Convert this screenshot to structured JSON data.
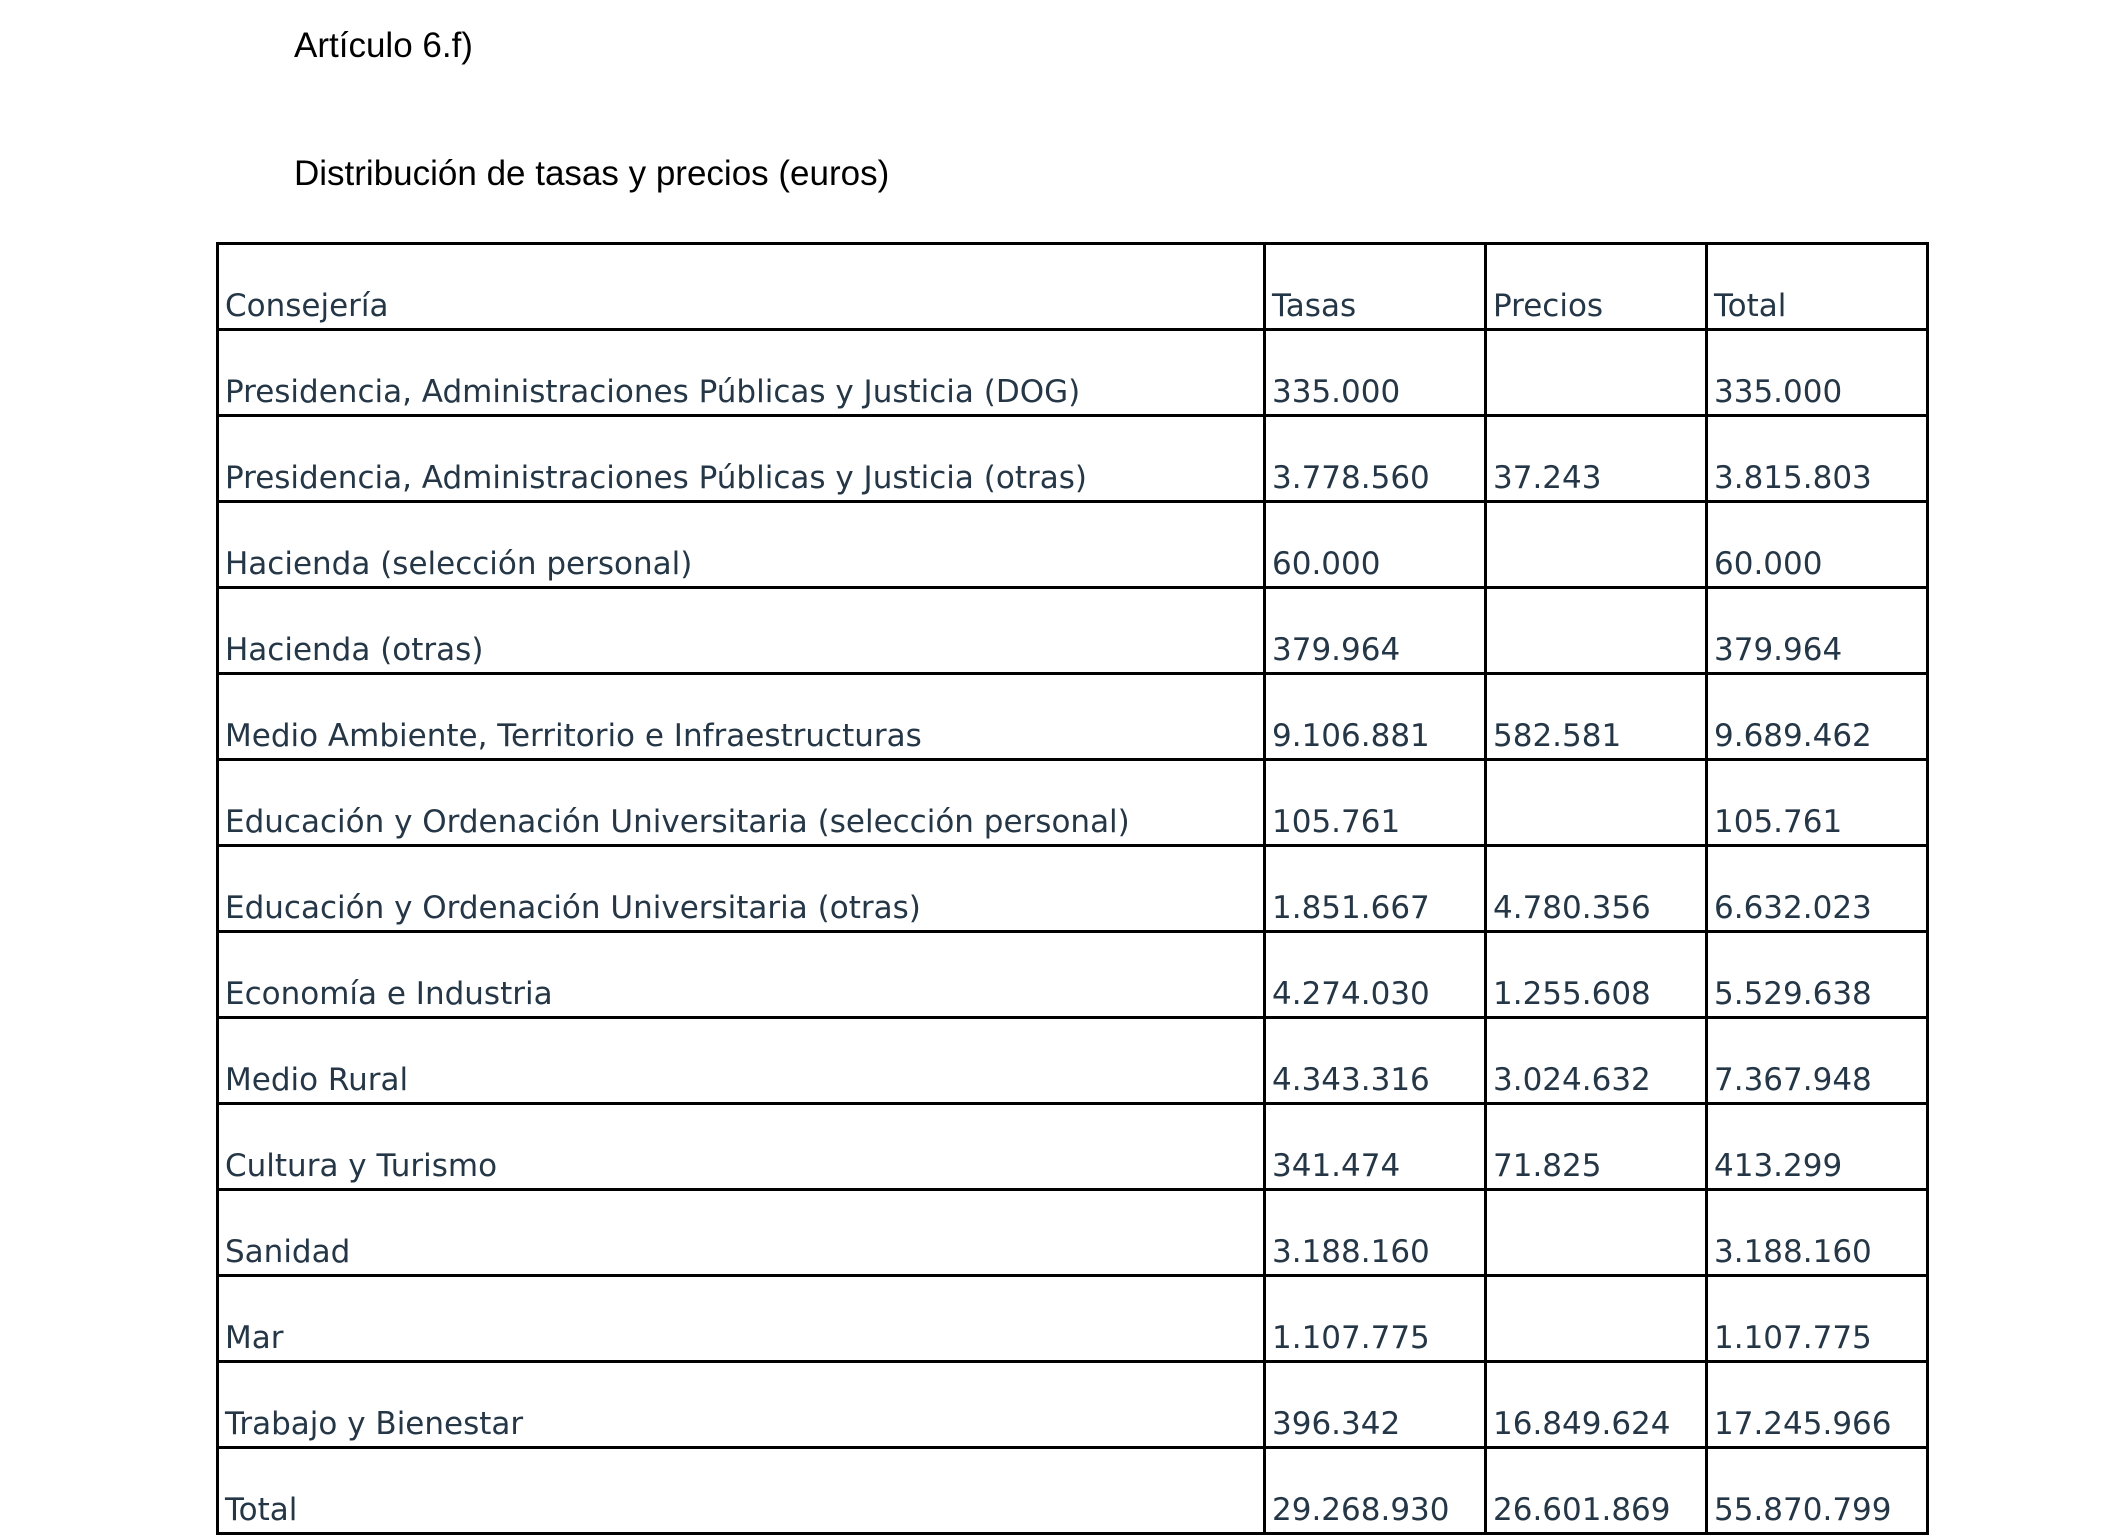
{
  "article": "Artículo 6.f)",
  "title": "Distribución de tasas y precios (euros)",
  "table": {
    "headers": [
      "Consejería",
      "Tasas",
      "Precios",
      "Total"
    ],
    "rows": [
      [
        "Presidencia, Administraciones Públicas y Justicia (DOG)",
        "335.000",
        "",
        "335.000"
      ],
      [
        "Presidencia, Administraciones Públicas y Justicia (otras)",
        "3.778.560",
        "37.243",
        "3.815.803"
      ],
      [
        "Hacienda (selección personal)",
        "60.000",
        "",
        "60.000"
      ],
      [
        "Hacienda (otras)",
        "379.964",
        "",
        "379.964"
      ],
      [
        "Medio Ambiente, Territorio e Infraestructuras",
        "9.106.881",
        "582.581",
        "9.689.462"
      ],
      [
        "Educación y Ordenación Universitaria (selección personal)",
        "105.761",
        "",
        "105.761"
      ],
      [
        "Educación y Ordenación Universitaria (otras)",
        "1.851.667",
        "4.780.356",
        "6.632.023"
      ],
      [
        "Economía e Industria",
        "4.274.030",
        "1.255.608",
        "5.529.638"
      ],
      [
        "Medio Rural",
        "4.343.316",
        "3.024.632",
        "7.367.948"
      ],
      [
        "Cultura y Turismo",
        "341.474",
        "71.825",
        "413.299"
      ],
      [
        "Sanidad",
        "3.188.160",
        "",
        "3.188.160"
      ],
      [
        "Mar",
        "1.107.775",
        "",
        "1.107.775"
      ],
      [
        "Trabajo y Bienestar",
        "396.342",
        "16.849.624",
        "17.245.966"
      ],
      [
        "Total",
        "29.268.930",
        "26.601.869",
        "55.870.799"
      ]
    ]
  }
}
